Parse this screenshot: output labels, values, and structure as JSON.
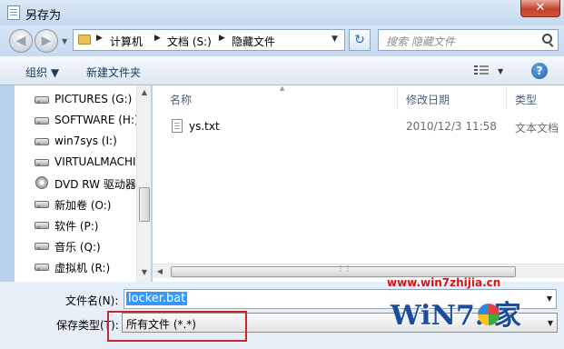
{
  "window": {
    "title": "另存为",
    "close_label": "✕"
  },
  "address": {
    "breadcrumbs": [
      "计算机",
      "文档 (S:)",
      "隐藏文件"
    ],
    "search_placeholder": "搜索 隐藏文件"
  },
  "toolbar": {
    "organize": "组织 ▼",
    "new_folder": "新建文件夹"
  },
  "nav": {
    "items": [
      {
        "label": "PICTURES (G:)",
        "icon": "drive-icon"
      },
      {
        "label": "SOFTWARE (H:)",
        "icon": "drive-icon"
      },
      {
        "label": "win7sys (I:)",
        "icon": "drive-icon"
      },
      {
        "label": "VIRTUALMACHI",
        "icon": "drive-icon"
      },
      {
        "label": "DVD RW 驱动器",
        "icon": "dvd-icon"
      },
      {
        "label": "新加卷 (O:)",
        "icon": "drive-icon"
      },
      {
        "label": "软件 (P:)",
        "icon": "drive-icon"
      },
      {
        "label": "音乐 (Q:)",
        "icon": "drive-icon"
      },
      {
        "label": "虚拟机 (R:)",
        "icon": "drive-icon"
      }
    ]
  },
  "files": {
    "columns": [
      "名称",
      "修改日期",
      "类型"
    ],
    "rows": [
      {
        "name": "ys.txt",
        "modified": "2010/12/3 11:58",
        "type": "文本文档"
      }
    ]
  },
  "save": {
    "filename_label": "文件名(N):",
    "filename_value": "locker.bat",
    "filetype_label": "保存类型(T):",
    "filetype_value": "所有文件 (*.*)"
  },
  "watermark": {
    "url": "www.win7zhijia.cn",
    "logo": "WiN7.  家"
  },
  "colors": {
    "highlight": "#3399ff",
    "annotation_red": "#c42a2a",
    "watermark_red": "#d01818"
  }
}
